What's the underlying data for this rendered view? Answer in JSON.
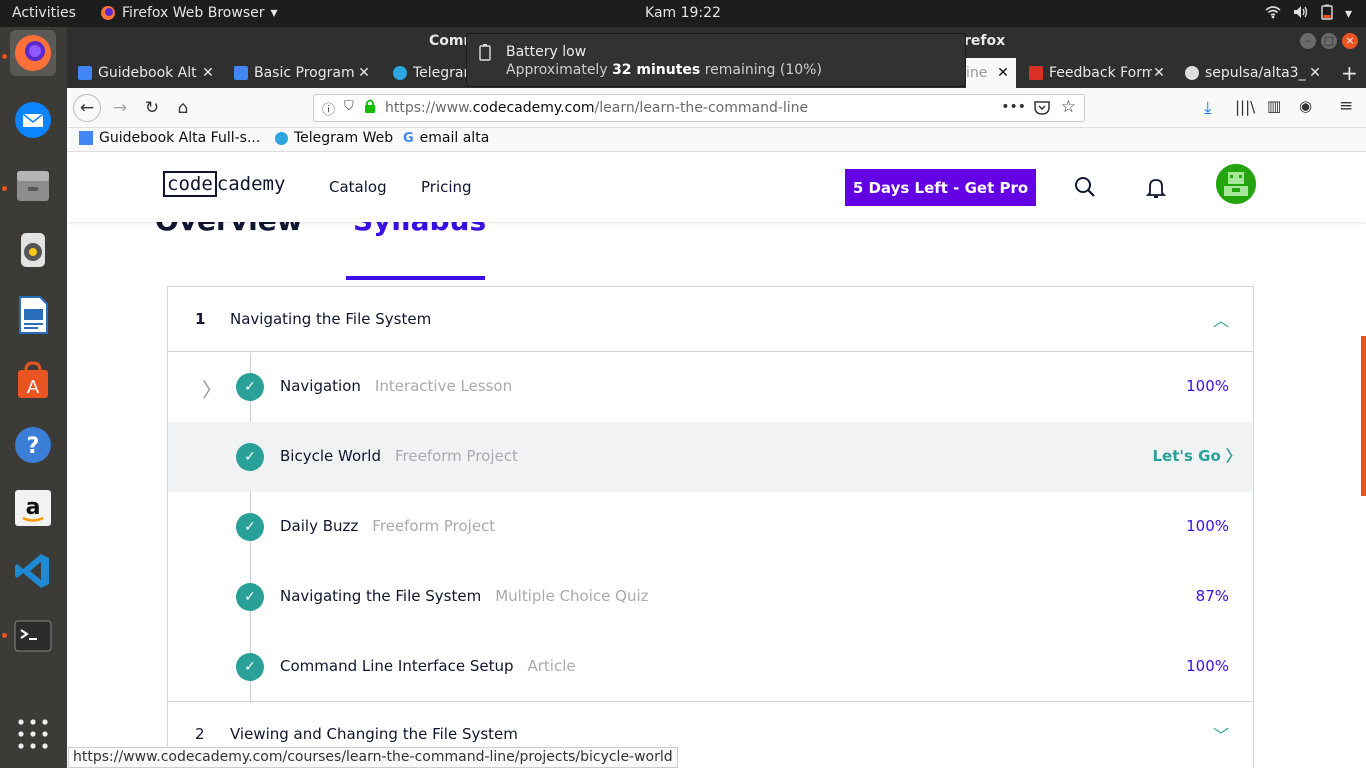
{
  "system": {
    "activities": "Activities",
    "app_name": "Firefox Web Browser",
    "clock": "Kam 19:22"
  },
  "window": {
    "title_left": "Comm",
    "title_right": "refox"
  },
  "notification": {
    "title": "Battery low",
    "body_prefix": "Approximately",
    "body_bold": "32 minutes",
    "body_suffix": "remaining (10%)"
  },
  "tabs": [
    {
      "label": "Guidebook Alt"
    },
    {
      "label": "Basic Program"
    },
    {
      "label": "Telegram"
    },
    {
      "label": "ine"
    },
    {
      "label": "Feedback Form"
    },
    {
      "label": "sepulsa/alta3_"
    }
  ],
  "navbar": {
    "url_prefix": "https://www.",
    "url_domain": "codecademy.com",
    "url_path": "/learn/learn-the-command-line"
  },
  "bookmarks": [
    {
      "label": "Guidebook Alta Full-s..."
    },
    {
      "label": "Telegram Web"
    },
    {
      "label": "email alta"
    }
  ],
  "site": {
    "logo_a": "code",
    "logo_b": "cademy",
    "catalog": "Catalog",
    "pricing": "Pricing",
    "pro_button": "5 Days Left - Get Pro",
    "tab_overview": "Overview",
    "tab_syllabus": "Syllabus"
  },
  "modules": [
    {
      "num": "1",
      "title": "Navigating the File System"
    },
    {
      "num": "2",
      "title": "Viewing and Changing the File System"
    }
  ],
  "lessons": [
    {
      "title": "Navigation",
      "type": "Interactive Lesson",
      "status": "100%"
    },
    {
      "title": "Bicycle World",
      "type": "Freeform Project",
      "status": "Let's Go"
    },
    {
      "title": "Daily Buzz",
      "type": "Freeform Project",
      "status": "100%"
    },
    {
      "title": "Navigating the File System",
      "type": "Multiple Choice Quiz",
      "status": "87%"
    },
    {
      "title": "Command Line Interface Setup",
      "type": "Article",
      "status": "100%"
    }
  ],
  "statusbar": {
    "url": "https://www.codecademy.com/courses/learn-the-command-line/projects/bicycle-world"
  },
  "colors": {
    "accent": "#3a10e5",
    "pro": "#6400e4",
    "check": "#2aa198",
    "ubuntu_orange": "#e95420"
  }
}
